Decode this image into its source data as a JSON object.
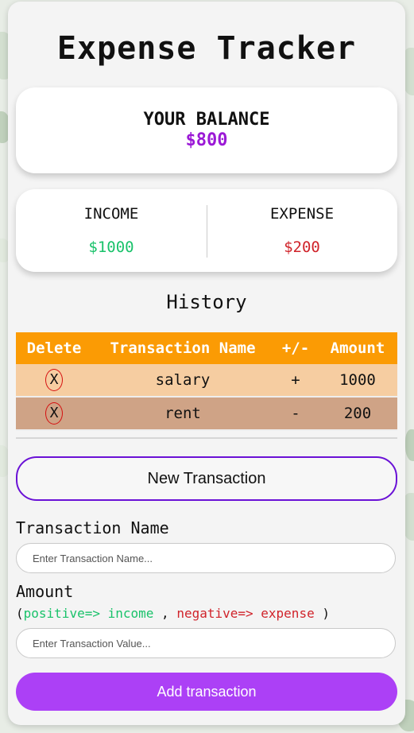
{
  "app": {
    "title": "Expense Tracker"
  },
  "balance": {
    "label": "YOUR BALANCE",
    "value": "$800"
  },
  "summary": {
    "income_label": "INCOME",
    "income_value": "$1000",
    "expense_label": "EXPENSE",
    "expense_value": "$200"
  },
  "history": {
    "title": "History",
    "headers": [
      "Delete",
      "Transaction Name",
      "+/-",
      "Amount"
    ],
    "rows": [
      {
        "delete": "X",
        "name": "salary",
        "sign": "+",
        "amount": "1000"
      },
      {
        "delete": "X",
        "name": "rent",
        "sign": "-",
        "amount": "200"
      }
    ]
  },
  "form": {
    "new_button": "New Transaction",
    "name_label": "Transaction Name",
    "name_placeholder": "Enter Transaction Name...",
    "amount_label": "Amount",
    "hint_open": "(",
    "hint_positive": "positive=> income",
    "hint_sep": " , ",
    "hint_negative": "negative=> expense",
    "hint_close": " )",
    "amount_placeholder": "Enter Transaction Value...",
    "submit": "Add transaction"
  },
  "colors": {
    "income": "#19c26a",
    "expense": "#d0232a",
    "accent": "#ac40f6",
    "header": "#fb9b04",
    "balance": "#9b19d6"
  }
}
